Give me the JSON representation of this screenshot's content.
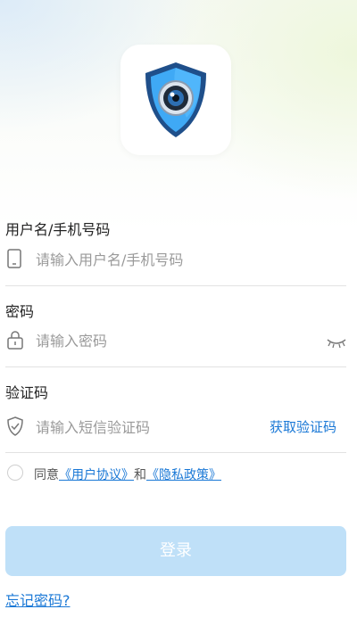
{
  "logo": {
    "icon": "shield-camera-icon"
  },
  "username": {
    "label": "用户名/手机号码",
    "placeholder": "请输入用户名/手机号码",
    "value": "",
    "icon": "phone-icon"
  },
  "password": {
    "label": "密码",
    "placeholder": "请输入密码",
    "value": "",
    "icon": "lock-icon",
    "toggle_icon": "eye-closed-icon"
  },
  "verification": {
    "label": "验证码",
    "placeholder": "请输入短信验证码",
    "value": "",
    "icon": "shield-check-icon",
    "get_code_label": "获取验证码"
  },
  "agreement": {
    "checked": false,
    "prefix": "同意",
    "user_agreement": "《用户协议》",
    "and": "和",
    "privacy_policy": "《隐私政策》"
  },
  "login_button": {
    "label": "登录"
  },
  "forgot_password": {
    "label": "忘记密码?"
  },
  "colors": {
    "accent": "#1a78d6",
    "button_disabled": "#bfe0f8",
    "divider": "#e2e2e2"
  }
}
